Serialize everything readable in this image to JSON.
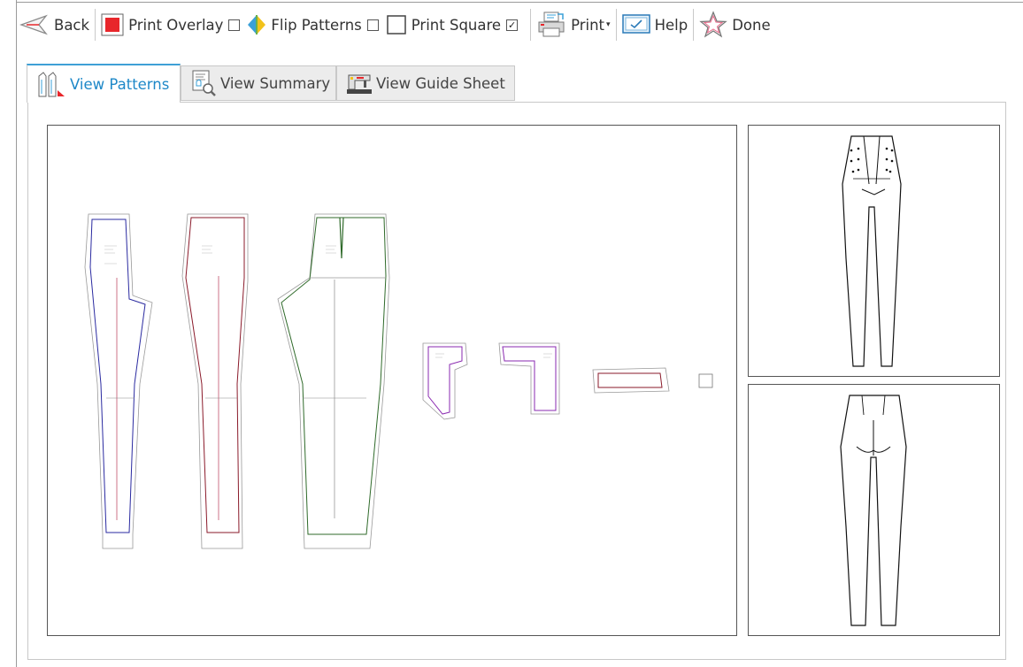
{
  "toolbar": {
    "back": "Back",
    "print_overlay": "Print Overlay",
    "print_overlay_checked": false,
    "flip_patterns": "Flip Patterns",
    "flip_patterns_checked": false,
    "print_square": "Print Square",
    "print_square_checked": true,
    "print": "Print",
    "help": "Help",
    "done": "Done"
  },
  "tabs": [
    {
      "label": "View Patterns",
      "active": true
    },
    {
      "label": "View Summary",
      "active": false
    },
    {
      "label": "View Guide Sheet",
      "active": false
    }
  ],
  "colors": {
    "accent": "#1e88c8",
    "overlay_red": "#e8262b",
    "piece_blue": "#2a2aa0",
    "piece_red": "#8a1a2a",
    "piece_green": "#2f6a2a",
    "piece_purple": "#8a2ab0"
  },
  "icons": {
    "back": "back-arrow-icon",
    "print_overlay": "red-square-icon",
    "flip_patterns": "flip-diamond-icon",
    "print_square": "square-outline-icon",
    "print": "printer-icon",
    "help": "help-monitor-icon",
    "done": "star-icon"
  }
}
